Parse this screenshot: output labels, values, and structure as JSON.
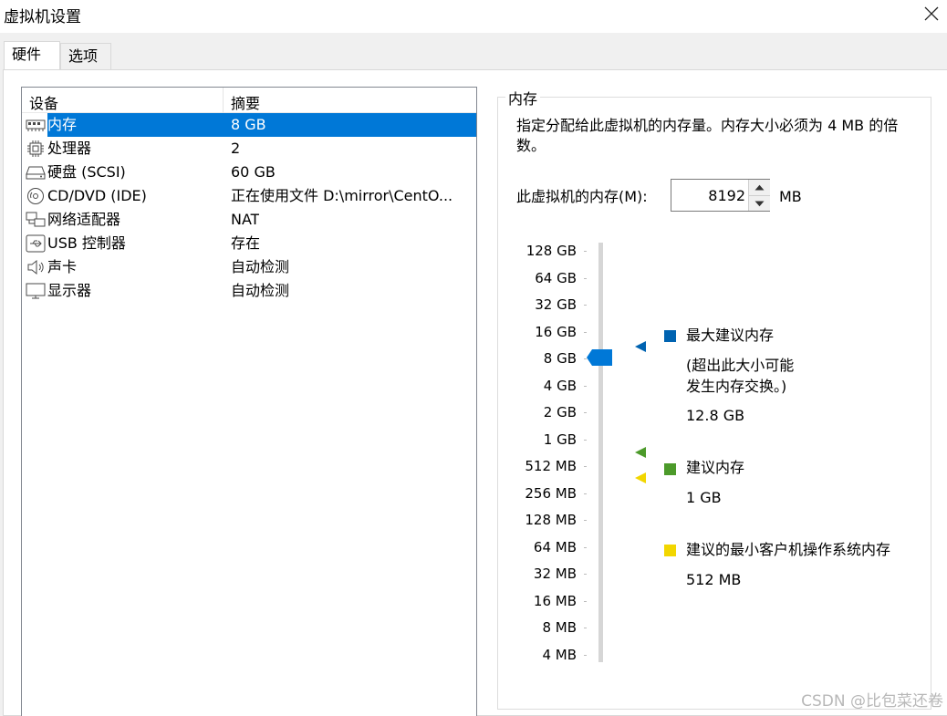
{
  "window": {
    "title": "虚拟机设置"
  },
  "tabs": [
    {
      "label": "硬件",
      "active": true
    },
    {
      "label": "选项",
      "active": false
    }
  ],
  "device_list": {
    "columns": {
      "device": "设备",
      "summary": "摘要"
    },
    "rows": [
      {
        "label": "内存",
        "summary": "8 GB",
        "icon": "memory-icon",
        "selected": true
      },
      {
        "label": "处理器",
        "summary": "2",
        "icon": "processor-icon"
      },
      {
        "label": "硬盘 (SCSI)",
        "summary": "60 GB",
        "icon": "hard-disk-icon"
      },
      {
        "label": "CD/DVD (IDE)",
        "summary": "正在使用文件 D:\\mirror\\CentO...",
        "icon": "cd-dvd-icon"
      },
      {
        "label": "网络适配器",
        "summary": "NAT",
        "icon": "network-adapter-icon"
      },
      {
        "label": "USB 控制器",
        "summary": "存在",
        "icon": "usb-icon"
      },
      {
        "label": "声卡",
        "summary": "自动检测",
        "icon": "speaker-icon"
      },
      {
        "label": "显示器",
        "summary": "自动检测",
        "icon": "monitor-icon"
      }
    ]
  },
  "memory": {
    "group_label": "内存",
    "description": "指定分配给此虚拟机的内存量。内存大小必须为 4 MB 的倍数。",
    "input_label": "此虚拟机的内存(M):",
    "value": "8192",
    "unit": "MB",
    "scale": [
      "128 GB",
      "64 GB",
      "32 GB",
      "16 GB",
      "8 GB",
      "4 GB",
      "2 GB",
      "1 GB",
      "512 MB",
      "256 MB",
      "128 MB",
      "64 MB",
      "32 MB",
      "16 MB",
      "8 MB",
      "4 MB"
    ],
    "current_level": "8 GB",
    "legend": {
      "max": {
        "title": "最大建议内存",
        "note_line1": "(超出此大小可能",
        "note_line2": "发生内存交换。)",
        "value": "12.8 GB",
        "color": "#0063b1"
      },
      "recommended": {
        "title": "建议内存",
        "value": "1 GB",
        "color": "#4c9a2a"
      },
      "min_guest": {
        "title": "建议的最小客户机操作系统内存",
        "value": "512 MB",
        "color": "#f2d600"
      }
    }
  },
  "watermark": "CSDN @比包菜还卷",
  "colors": {
    "selection": "#0078d7",
    "thumb": "#0078d7"
  }
}
